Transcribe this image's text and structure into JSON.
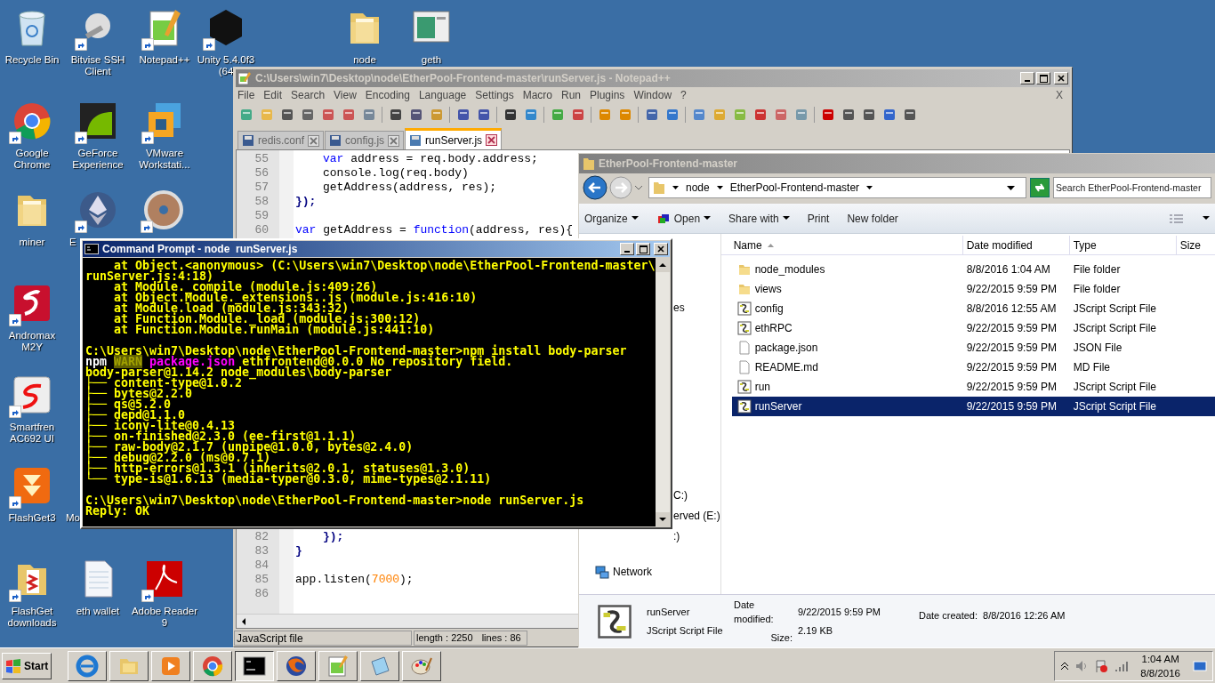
{
  "desktop_icons": [
    {
      "label": [
        "Recycle Bin"
      ]
    },
    {
      "label": [
        "Bitvise SSH",
        "Client"
      ]
    },
    {
      "label": [
        "Notepad++"
      ]
    },
    {
      "label": [
        "Unity 5.4.0f3",
        "(64"
      ]
    },
    {
      "label": [
        "node"
      ]
    },
    {
      "label": [
        "geth"
      ]
    },
    {
      "label": [
        "Google",
        "Chrome"
      ]
    },
    {
      "label": [
        "GeForce",
        "Experience"
      ]
    },
    {
      "label": [
        "VMware",
        "Workstati..."
      ]
    },
    {
      "label": [
        "miner"
      ]
    },
    {
      "label": [
        "E"
      ]
    },
    {
      "label": [
        "Andromax",
        "M2Y"
      ]
    },
    {
      "label": [
        "Smartfren",
        "AC692 UI"
      ]
    },
    {
      "label": [
        "FlashGet3"
      ]
    },
    {
      "label": [
        "Mo"
      ]
    },
    {
      "label": [
        "FlashGet",
        "downloads"
      ]
    },
    {
      "label": [
        "eth wallet"
      ]
    },
    {
      "label": [
        "Adobe Reader",
        "9"
      ]
    }
  ],
  "notepad": {
    "title": "C:\\Users\\win7\\Desktop\\node\\EtherPool-Frontend-master\\runServer.js - Notepad++",
    "menu": [
      "File",
      "Edit",
      "Search",
      "View",
      "Encoding",
      "Language",
      "Settings",
      "Macro",
      "Run",
      "Plugins",
      "Window",
      "?"
    ],
    "menu_close": "X",
    "tabs": [
      {
        "label": "redis.conf",
        "selected": false
      },
      {
        "label": "config.js",
        "selected": false
      },
      {
        "label": "runServer.js",
        "selected": true
      }
    ],
    "code_top": [
      {
        "number": "55",
        "indented": true,
        "segments": [
          {
            "kind": "keyword",
            "text": "var"
          },
          {
            "kind": "plain",
            "text": " address = req.body.address;"
          }
        ]
      },
      {
        "number": "56",
        "indented": true,
        "segments": [
          {
            "kind": "plain",
            "text": "console.log(req.body)"
          }
        ]
      },
      {
        "number": "57",
        "indented": true,
        "segments": [
          {
            "kind": "plain",
            "text": "getAddress(address, res);"
          }
        ]
      },
      {
        "number": "58",
        "indented": false,
        "segments": [
          {
            "kind": "operator",
            "text": "});"
          }
        ]
      },
      {
        "number": "59"
      },
      {
        "number": "60",
        "indented": false,
        "segments": [
          {
            "kind": "keyword",
            "text": "var"
          },
          {
            "kind": "plain",
            "text": " getAddress = "
          },
          {
            "kind": "keyword",
            "text": "function"
          },
          {
            "kind": "plain",
            "text": "(address, res){"
          }
        ]
      }
    ],
    "code_bottom": [
      {
        "number": "82",
        "indented": true,
        "segments": [
          {
            "kind": "operator",
            "text": "});"
          }
        ]
      },
      {
        "number": "83",
        "indented": false,
        "segments": [
          {
            "kind": "operator",
            "text": "}"
          }
        ]
      },
      {
        "number": "84"
      },
      {
        "number": "85",
        "indented": false,
        "segments": [
          {
            "kind": "plain",
            "text": "app.listen("
          },
          {
            "kind": "number",
            "text": "7000"
          },
          {
            "kind": "plain",
            "text": ");"
          }
        ]
      },
      {
        "number": "86"
      }
    ],
    "status": {
      "file_type": "JavaScript file",
      "length": "length : 2250",
      "lines": "lines : 86"
    }
  },
  "explorer": {
    "title": "EtherPool-Frontend-master",
    "breadcrumbs": [
      "node",
      "EtherPool-Frontend-master"
    ],
    "search": {
      "placeholder": "Search EtherPool-Frontend-master"
    },
    "toolbar": [
      "Organize",
      "Open",
      "Share with",
      "Print",
      "New folder"
    ],
    "nav_fragments": [
      "es",
      "C:)",
      "erved (E:)",
      ":)"
    ],
    "nav_network": "Network",
    "columns": [
      "Name",
      "Date modified",
      "Type",
      "Size"
    ],
    "rows": [
      {
        "kind": "folder",
        "name": "node_modules",
        "date": "8/8/2016 1:04 AM",
        "type": "File folder",
        "selected": false
      },
      {
        "kind": "folder",
        "name": "views",
        "date": "9/22/2015 9:59 PM",
        "type": "File folder",
        "selected": false
      },
      {
        "kind": "script",
        "name": "config",
        "date": "8/8/2016 12:55 AM",
        "type": "JScript Script File",
        "selected": false
      },
      {
        "kind": "script",
        "name": "ethRPC",
        "date": "9/22/2015 9:59 PM",
        "type": "JScript Script File",
        "selected": false
      },
      {
        "kind": "file",
        "name": "package.json",
        "date": "9/22/2015 9:59 PM",
        "type": "JSON File",
        "selected": false
      },
      {
        "kind": "file",
        "name": "README.md",
        "date": "9/22/2015 9:59 PM",
        "type": "MD File",
        "selected": false
      },
      {
        "kind": "script",
        "name": "run",
        "date": "9/22/2015 9:59 PM",
        "type": "JScript Script File",
        "selected": false
      },
      {
        "kind": "script",
        "name": "runServer",
        "date": "9/22/2015 9:59 PM",
        "type": "JScript Script File",
        "selected": true
      }
    ],
    "details": {
      "name": "runServer",
      "type": "JScript Script File",
      "modified_label": "Date modified:",
      "modified": "9/22/2015 9:59 PM",
      "size_label": "Size:",
      "size": "2.19 KB",
      "created_label": "Date created:",
      "created": "8/8/2016 12:26 AM"
    }
  },
  "cmd": {
    "title": "Command Prompt - node  runServer.js",
    "lines": [
      {
        "gap_before": false,
        "segments": [
          {
            "kind": "text",
            "text": "    at Object.<anonymous> (C:\\Users\\win7\\Desktop\\node\\EtherPool-Frontend-master\\"
          }
        ]
      },
      {
        "gap_before": false,
        "segments": [
          {
            "kind": "text",
            "text": "runServer.js:4:18)"
          }
        ]
      },
      {
        "gap_before": false,
        "segments": [
          {
            "kind": "text",
            "text": "    at Module._compile (module.js:409:26)"
          }
        ]
      },
      {
        "gap_before": false,
        "segments": [
          {
            "kind": "text",
            "text": "    at Object.Module._extensions..js (module.js:416:10)"
          }
        ]
      },
      {
        "gap_before": false,
        "segments": [
          {
            "kind": "text",
            "text": "    at Module.load (module.js:343:32)"
          }
        ]
      },
      {
        "gap_before": false,
        "segments": [
          {
            "kind": "text",
            "text": "    at Function.Module._load (module.js:300:12)"
          }
        ]
      },
      {
        "gap_before": false,
        "segments": [
          {
            "kind": "text",
            "text": "    at Function.Module.runMain (module.js:441:10)"
          }
        ]
      },
      {
        "gap_before": true,
        "segments": [
          {
            "kind": "text",
            "text": "C:\\Users\\win7\\Desktop\\node\\EtherPool-Frontend-master>npm install body-parser"
          }
        ]
      },
      {
        "gap_before": false,
        "segments": [
          {
            "kind": "white",
            "text": "npm "
          },
          {
            "kind": "warn",
            "text": "WARN"
          },
          {
            "kind": "magenta",
            "text": " package.json"
          },
          {
            "kind": "text",
            "text": " ethfrontend@0.0.0 No repository field."
          }
        ]
      },
      {
        "gap_before": false,
        "segments": [
          {
            "kind": "text",
            "text": "body-parser@1.14.2 node_modules\\body-parser"
          }
        ]
      },
      {
        "gap_before": false,
        "segments": [
          {
            "kind": "text",
            "text": "├── content-type@1.0.2"
          }
        ]
      },
      {
        "gap_before": false,
        "segments": [
          {
            "kind": "text",
            "text": "├── bytes@2.2.0"
          }
        ]
      },
      {
        "gap_before": false,
        "segments": [
          {
            "kind": "text",
            "text": "├── qs@5.2.0"
          }
        ]
      },
      {
        "gap_before": false,
        "segments": [
          {
            "kind": "text",
            "text": "├── depd@1.1.0"
          }
        ]
      },
      {
        "gap_before": false,
        "segments": [
          {
            "kind": "text",
            "text": "├── iconv-lite@0.4.13"
          }
        ]
      },
      {
        "gap_before": false,
        "segments": [
          {
            "kind": "text",
            "text": "├── on-finished@2.3.0 (ee-first@1.1.1)"
          }
        ]
      },
      {
        "gap_before": false,
        "segments": [
          {
            "kind": "text",
            "text": "├── raw-body@2.1.7 (unpipe@1.0.0, bytes@2.4.0)"
          }
        ]
      },
      {
        "gap_before": false,
        "segments": [
          {
            "kind": "text",
            "text": "├── debug@2.2.0 (ms@0.7.1)"
          }
        ]
      },
      {
        "gap_before": false,
        "segments": [
          {
            "kind": "text",
            "text": "├── http-errors@1.3.1 (inherits@2.0.1, statuses@1.3.0)"
          }
        ]
      },
      {
        "gap_before": false,
        "segments": [
          {
            "kind": "text",
            "text": "└── type-is@1.6.13 (media-typer@0.3.0, mime-types@2.1.11)"
          }
        ]
      },
      {
        "gap_before": true,
        "segments": [
          {
            "kind": "text",
            "text": "C:\\Users\\win7\\Desktop\\node\\EtherPool-Frontend-master>node runServer.js"
          }
        ]
      },
      {
        "gap_before": false,
        "segments": [
          {
            "kind": "text",
            "text": "Reply: OK"
          }
        ]
      }
    ]
  },
  "taskbar": {
    "start": "Start",
    "apps": [
      {
        "selected": false
      },
      {
        "selected": false
      },
      {
        "selected": false
      },
      {
        "selected": false
      },
      {
        "selected": true
      },
      {
        "selected": false
      },
      {
        "selected": false
      },
      {
        "selected": false
      },
      {
        "selected": false
      }
    ],
    "time": "1:04 AM",
    "date": "8/8/2016"
  }
}
